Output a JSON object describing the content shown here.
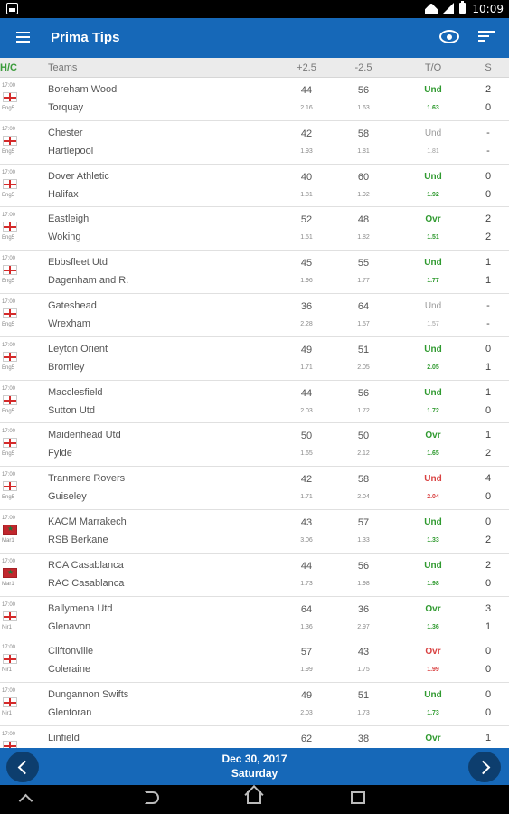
{
  "status_bar": {
    "time": "10:09"
  },
  "app_bar": {
    "title": "Prima Tips"
  },
  "columns": {
    "hc": "H/C",
    "teams": "Teams",
    "plus": "+2.5",
    "minus": "-2.5",
    "to": "T/O",
    "s": "S"
  },
  "matches": [
    {
      "time": "17:00",
      "league": "Eng5",
      "flag": "eng",
      "home": "Boreham Wood",
      "away": "Torquay",
      "plus": "44",
      "minus": "56",
      "odd_plus": "2.16",
      "odd_minus": "1.63",
      "tip": "Und",
      "tip_odd": "1.63",
      "tip_color": "green",
      "score_home": "2",
      "score_away": "0"
    },
    {
      "time": "17:00",
      "league": "Eng5",
      "flag": "eng",
      "home": "Chester",
      "away": "Hartlepool",
      "plus": "42",
      "minus": "58",
      "odd_plus": "1.93",
      "odd_minus": "1.81",
      "tip": "Und",
      "tip_odd": "1.81",
      "tip_color": "grey",
      "score_home": "-",
      "score_away": "-"
    },
    {
      "time": "17:00",
      "league": "Eng5",
      "flag": "eng",
      "home": "Dover Athletic",
      "away": "Halifax",
      "plus": "40",
      "minus": "60",
      "odd_plus": "1.81",
      "odd_minus": "1.92",
      "tip": "Und",
      "tip_odd": "1.92",
      "tip_color": "green",
      "score_home": "0",
      "score_away": "0"
    },
    {
      "time": "17:00",
      "league": "Eng5",
      "flag": "eng",
      "home": "Eastleigh",
      "away": "Woking",
      "plus": "52",
      "minus": "48",
      "odd_plus": "1.51",
      "odd_minus": "1.82",
      "tip": "Ovr",
      "tip_odd": "1.51",
      "tip_color": "green",
      "score_home": "2",
      "score_away": "2"
    },
    {
      "time": "17:00",
      "league": "Eng5",
      "flag": "eng",
      "home": "Ebbsfleet Utd",
      "away": "Dagenham and R.",
      "plus": "45",
      "minus": "55",
      "odd_plus": "1.96",
      "odd_minus": "1.77",
      "tip": "Und",
      "tip_odd": "1.77",
      "tip_color": "green",
      "score_home": "1",
      "score_away": "1"
    },
    {
      "time": "17:00",
      "league": "Eng5",
      "flag": "eng",
      "home": "Gateshead",
      "away": "Wrexham",
      "plus": "36",
      "minus": "64",
      "odd_plus": "2.28",
      "odd_minus": "1.57",
      "tip": "Und",
      "tip_odd": "1.57",
      "tip_color": "grey",
      "score_home": "-",
      "score_away": "-"
    },
    {
      "time": "17:00",
      "league": "Eng5",
      "flag": "eng",
      "home": "Leyton Orient",
      "away": "Bromley",
      "plus": "49",
      "minus": "51",
      "odd_plus": "1.71",
      "odd_minus": "2.05",
      "tip": "Und",
      "tip_odd": "2.05",
      "tip_color": "green",
      "score_home": "0",
      "score_away": "1"
    },
    {
      "time": "17:00",
      "league": "Eng5",
      "flag": "eng",
      "home": "Macclesfield",
      "away": "Sutton Utd",
      "plus": "44",
      "minus": "56",
      "odd_plus": "2.03",
      "odd_minus": "1.72",
      "tip": "Und",
      "tip_odd": "1.72",
      "tip_color": "green",
      "score_home": "1",
      "score_away": "0"
    },
    {
      "time": "17:00",
      "league": "Eng5",
      "flag": "eng",
      "home": "Maidenhead Utd",
      "away": "Fylde",
      "plus": "50",
      "minus": "50",
      "odd_plus": "1.65",
      "odd_minus": "2.12",
      "tip": "Ovr",
      "tip_odd": "1.65",
      "tip_color": "green",
      "score_home": "1",
      "score_away": "2"
    },
    {
      "time": "17:00",
      "league": "Eng5",
      "flag": "eng",
      "home": "Tranmere Rovers",
      "away": "Guiseley",
      "plus": "42",
      "minus": "58",
      "odd_plus": "1.71",
      "odd_minus": "2.04",
      "tip": "Und",
      "tip_odd": "2.04",
      "tip_color": "red",
      "score_home": "4",
      "score_away": "0"
    },
    {
      "time": "17:00",
      "league": "Mar1",
      "flag": "mar",
      "home": "KACM Marrakech",
      "away": "RSB Berkane",
      "plus": "43",
      "minus": "57",
      "odd_plus": "3.06",
      "odd_minus": "1.33",
      "tip": "Und",
      "tip_odd": "1.33",
      "tip_color": "green",
      "score_home": "0",
      "score_away": "2"
    },
    {
      "time": "17:00",
      "league": "Mar1",
      "flag": "mar",
      "home": "RCA Casablanca",
      "away": "RAC Casablanca",
      "plus": "44",
      "minus": "56",
      "odd_plus": "1.73",
      "odd_minus": "1.98",
      "tip": "Und",
      "tip_odd": "1.98",
      "tip_color": "green",
      "score_home": "2",
      "score_away": "0"
    },
    {
      "time": "17:00",
      "league": "Nir1",
      "flag": "eng",
      "home": "Ballymena Utd",
      "away": "Glenavon",
      "plus": "64",
      "minus": "36",
      "odd_plus": "1.36",
      "odd_minus": "2.97",
      "tip": "Ovr",
      "tip_odd": "1.36",
      "tip_color": "green",
      "score_home": "3",
      "score_away": "1"
    },
    {
      "time": "17:00",
      "league": "Nir1",
      "flag": "eng",
      "home": "Cliftonville",
      "away": "Coleraine",
      "plus": "57",
      "minus": "43",
      "odd_plus": "1.99",
      "odd_minus": "1.75",
      "tip": "Ovr",
      "tip_odd": "1.99",
      "tip_color": "red",
      "score_home": "0",
      "score_away": "0"
    },
    {
      "time": "17:00",
      "league": "Nir1",
      "flag": "eng",
      "home": "Dungannon Swifts",
      "away": "Glentoran",
      "plus": "49",
      "minus": "51",
      "odd_plus": "2.03",
      "odd_minus": "1.73",
      "tip": "Und",
      "tip_odd": "1.73",
      "tip_color": "green",
      "score_home": "0",
      "score_away": "0"
    },
    {
      "time": "17:00",
      "league": "Nir1",
      "flag": "eng",
      "home": "Linfield",
      "away": "",
      "plus": "62",
      "minus": "38",
      "odd_plus": "",
      "odd_minus": "",
      "tip": "Ovr",
      "tip_odd": "",
      "tip_color": "green",
      "score_home": "1",
      "score_away": ""
    }
  ],
  "footer": {
    "date": "Dec 30, 2017",
    "day": "Saturday"
  },
  "icons": {
    "menu": "menu-icon",
    "eye": "eye-icon",
    "sort": "sort-icon",
    "prev": "chevron-left-icon",
    "next": "chevron-right-icon"
  },
  "colors": {
    "accent": "#1668b8",
    "green": "#2f9a2f",
    "red": "#d94141",
    "grey": "#9a9a9a"
  }
}
